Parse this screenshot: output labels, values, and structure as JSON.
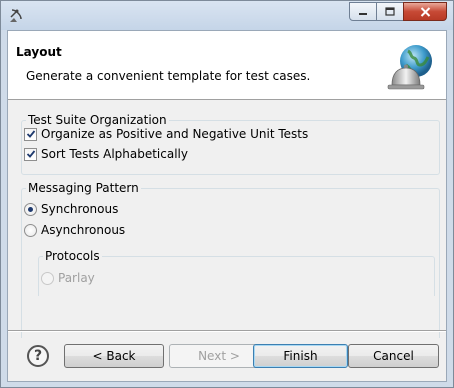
{
  "window": {
    "app_icon": "satellite-dish-icon",
    "minimize_icon": "minimize-icon",
    "maximize_icon": "maximize-icon",
    "close_icon": "close-icon"
  },
  "header": {
    "title": "Layout",
    "description": "Generate a convenient template for test cases.",
    "image": "globe-service-bell-icon"
  },
  "test_suite": {
    "title": "Test Suite Organization",
    "options": [
      {
        "label": "Organize as Positive and Negative Unit Tests",
        "checked": true
      },
      {
        "label": "Sort Tests Alphabetically",
        "checked": true
      }
    ]
  },
  "messaging": {
    "title": "Messaging Pattern",
    "options": [
      {
        "label": "Synchronous",
        "selected": true
      },
      {
        "label": "Asynchronous",
        "selected": false
      }
    ],
    "protocols": {
      "title": "Protocols",
      "options": [
        {
          "label": "Parlay",
          "selected": false,
          "enabled": false
        }
      ]
    }
  },
  "footer": {
    "help_icon": "help-icon",
    "help_label": "?",
    "back_label": "< Back",
    "next_label": "Next >",
    "finish_label": "Finish",
    "cancel_label": "Cancel"
  }
}
